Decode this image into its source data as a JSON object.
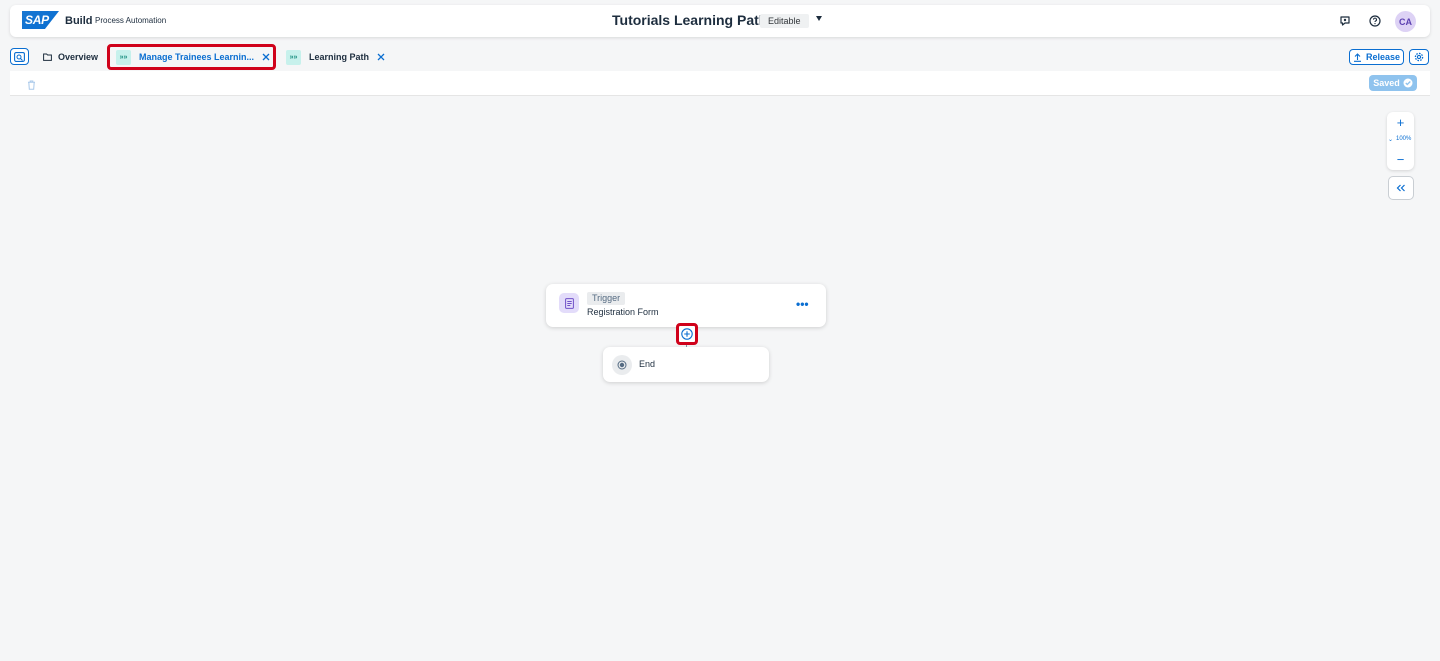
{
  "shellbar": {
    "logo_text": "SAP",
    "product": "Build",
    "product_sub": "Process Automation",
    "title": "Tutorials Learning Path",
    "status_badge": "Editable",
    "avatar_initials": "CA"
  },
  "tabs": {
    "overview_label": "Overview",
    "items": [
      {
        "label": "Manage Trainees Learnin...",
        "active": true
      },
      {
        "label": "Learning Path",
        "active": false
      }
    ],
    "tab_icon_glyph": "»»",
    "release_label": "Release"
  },
  "toolbar": {
    "saved_label": "Saved"
  },
  "canvas": {
    "zoom_plus": "+",
    "zoom_level": "100%",
    "zoom_minus": "−",
    "zoom_caret": "⌄",
    "trigger": {
      "badge": "Trigger",
      "name": "Registration Form",
      "more": "•••"
    },
    "end": {
      "label": "End"
    }
  },
  "colors": {
    "accent": "#0a6ed1",
    "highlight_red": "#d0021b",
    "saved_badge": "#8fc3ee",
    "avatar_bg": "#ddd2f5",
    "tab_icon_bg": "#c7f1ec"
  }
}
